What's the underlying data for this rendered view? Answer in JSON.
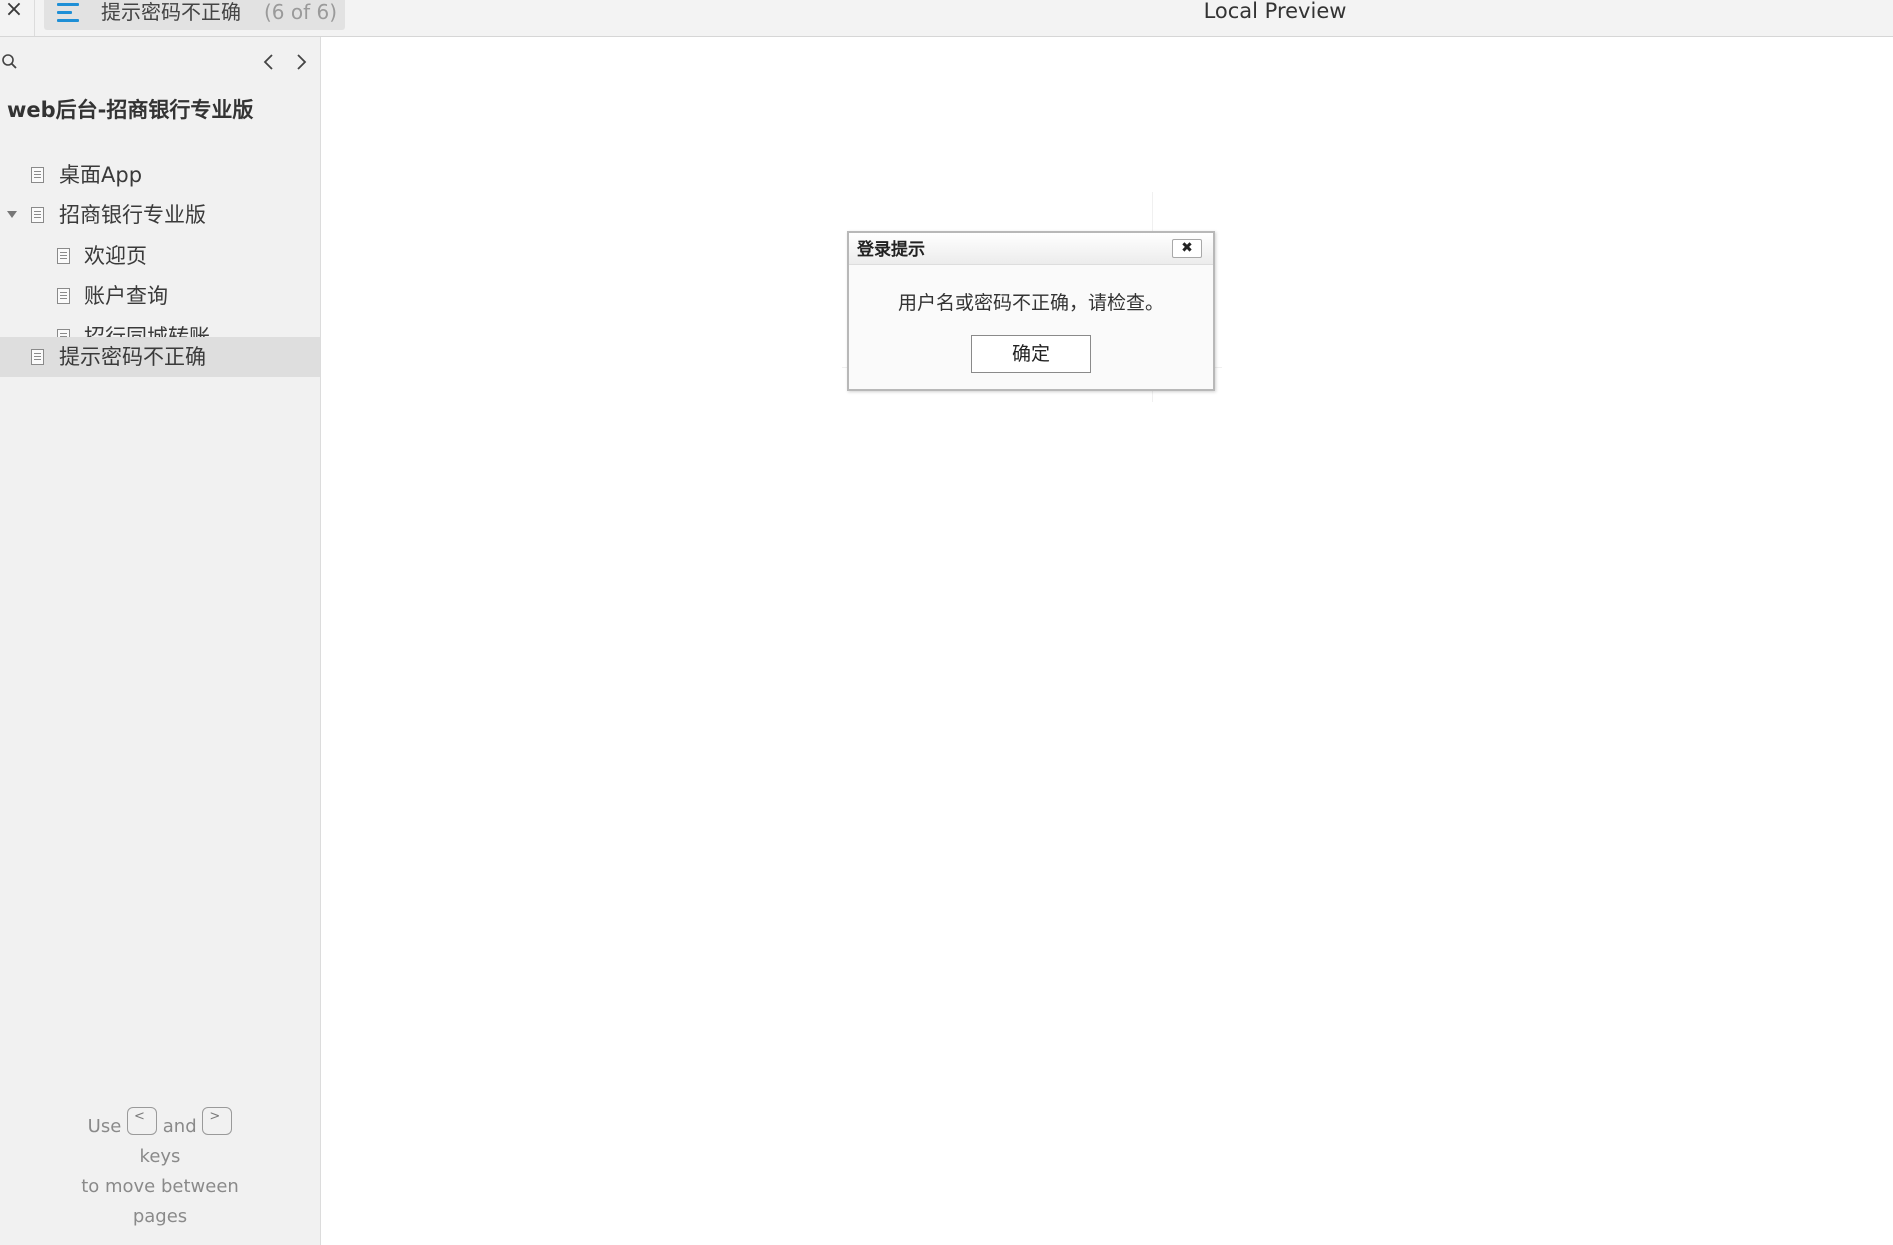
{
  "topbar": {
    "close_glyph": "×",
    "page_tab": {
      "title": "提示密码不正确",
      "count": "(6 of 6)"
    },
    "window_title": "Local Preview",
    "accent_color": "#1e8fd6"
  },
  "sidebar": {
    "project_title": "web后台-招商银行专业版",
    "items": [
      {
        "label": "桌面App",
        "level": 0,
        "expanded": null,
        "selected": false
      },
      {
        "label": "招商银行专业版",
        "level": 0,
        "expanded": true,
        "selected": false
      },
      {
        "label": "欢迎页",
        "level": 1,
        "expanded": null,
        "selected": false
      },
      {
        "label": "账户查询",
        "level": 1,
        "expanded": null,
        "selected": false
      },
      {
        "label": "招行同城转账",
        "level": 1,
        "expanded": null,
        "selected": false
      },
      {
        "label": "提示密码不正确",
        "level": 0,
        "expanded": null,
        "selected": true
      }
    ],
    "hint": {
      "use": "Use",
      "and": "and",
      "keys": "keys",
      "line2": "to move between",
      "line3": "pages",
      "prev_key": "<",
      "next_key": ">"
    }
  },
  "dialog": {
    "title": "登录提示",
    "close_glyph": "✖",
    "message": "用户名或密码不正确，请检查。",
    "ok_label": "确定"
  }
}
